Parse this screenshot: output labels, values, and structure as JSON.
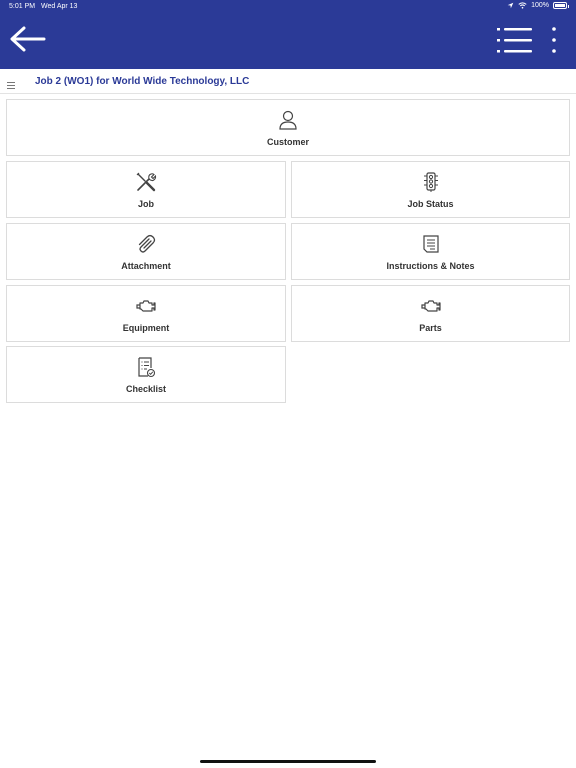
{
  "status_bar": {
    "time": "5:01 PM",
    "date": "Wed Apr 13",
    "battery": "100%",
    "icons": [
      "location-arrow-icon",
      "wifi-icon",
      "battery-icon"
    ]
  },
  "app_bar": {
    "background_color": "#2b3a97",
    "back_icon": "arrow-left-icon",
    "list_icon": "list-icon",
    "more_icon": "vertical-dots-icon"
  },
  "job_header": {
    "menu_icon": "hamburger-icon",
    "title": "Job 2 (WO1) for World Wide Technology, LLC",
    "title_color": "#2b3a97"
  },
  "tiles": [
    {
      "label": "Customer",
      "icon": "person-icon"
    },
    {
      "label": "Job",
      "icon": "tools-icon"
    },
    {
      "label": "Job Status",
      "icon": "traffic-light-icon"
    },
    {
      "label": "Attachment",
      "icon": "paperclip-icon"
    },
    {
      "label": "Instructions & Notes",
      "icon": "notes-icon"
    },
    {
      "label": "Equipment",
      "icon": "engine-icon"
    },
    {
      "label": "Parts",
      "icon": "engine-icon"
    },
    {
      "label": "Checklist",
      "icon": "checklist-icon"
    }
  ]
}
